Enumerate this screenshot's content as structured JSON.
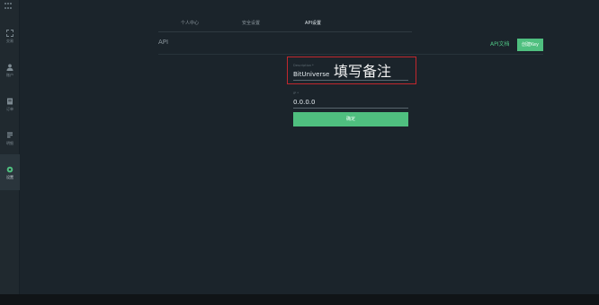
{
  "sidebar": {
    "items": [
      {
        "label": "交易",
        "icon": "expand-icon"
      },
      {
        "label": "账户",
        "icon": "user-icon"
      },
      {
        "label": "订单",
        "icon": "order-icon"
      },
      {
        "label": "明细",
        "icon": "details-icon"
      },
      {
        "label": "设置",
        "icon": "settings-icon"
      }
    ],
    "active_index": 4
  },
  "tabs": [
    "个人中心",
    "安全设置",
    "API设置"
  ],
  "active_tab": "API设置",
  "section": {
    "title": "API",
    "doc_link": "API文档",
    "create_button": "创建Key"
  },
  "form": {
    "remark": {
      "label": "Description *",
      "value": "BitUniverse"
    },
    "ip": {
      "label": "IP *",
      "value": "0.0.0.0"
    },
    "confirm_button": "确定"
  },
  "annotation": "填写备注",
  "colors": {
    "accent": "#4fbf7f",
    "highlight_border": "#c1272d",
    "background": "#1b242b"
  }
}
